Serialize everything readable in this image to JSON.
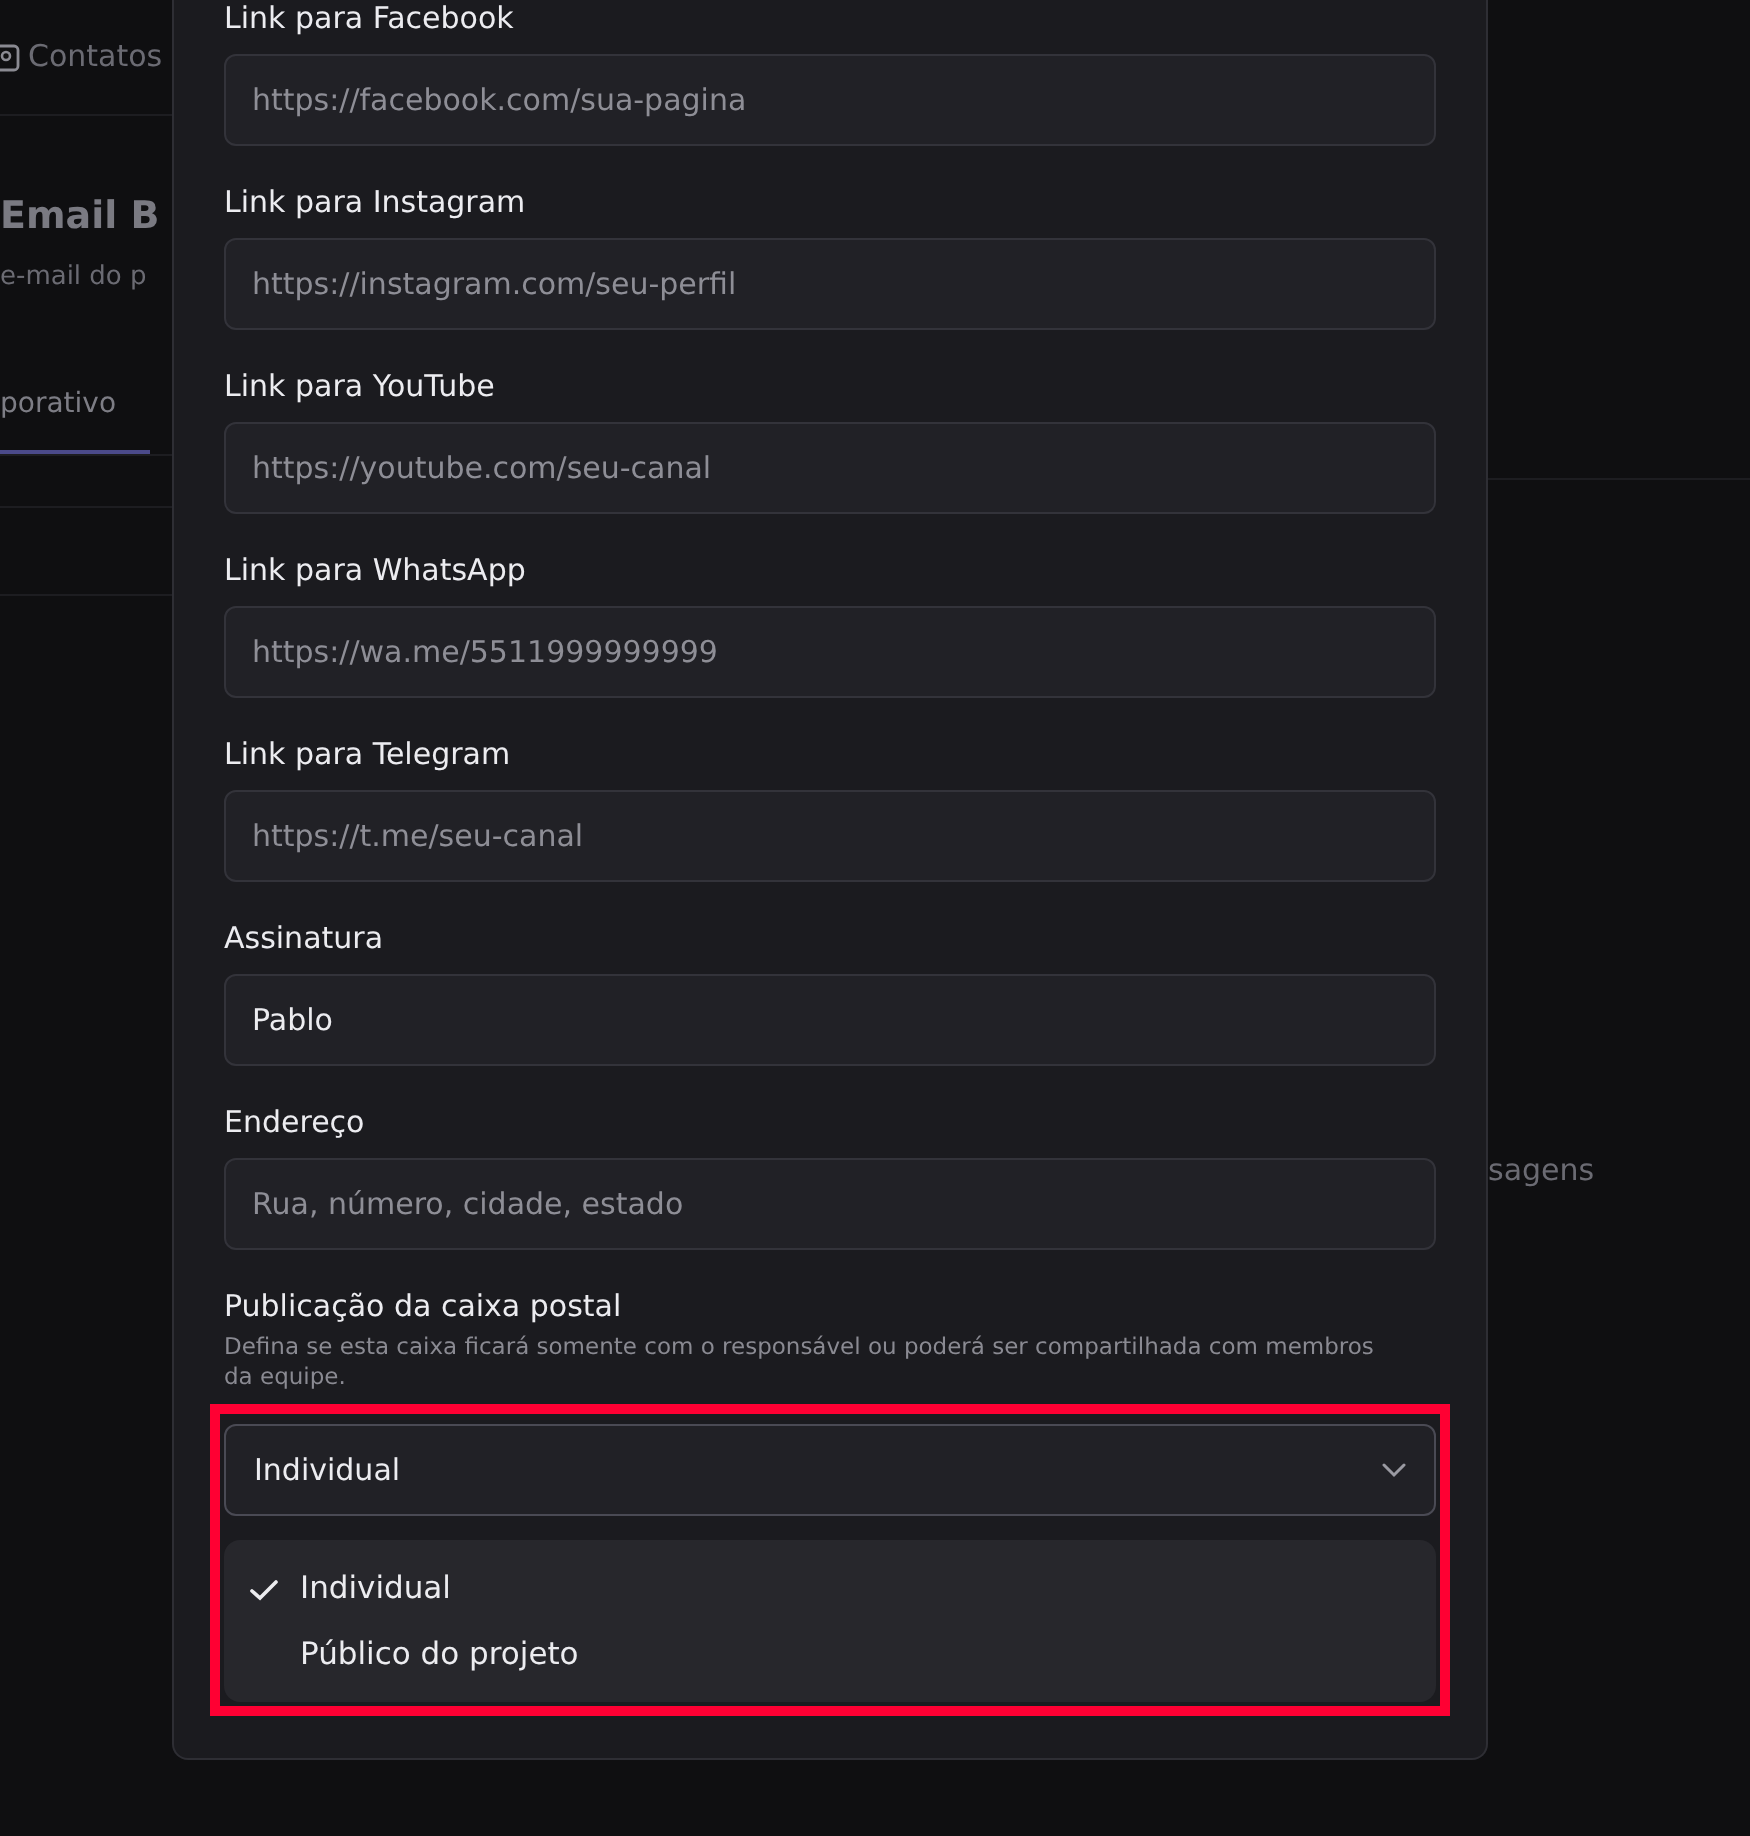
{
  "background": {
    "nav_item": "Contatos",
    "title": "Email B",
    "subtitle": "e-mail do p",
    "tab": {
      "label": "porativo",
      "selected": true
    },
    "side_text": "sagens"
  },
  "modal": {
    "fields": [
      {
        "label": "Link para Facebook",
        "placeholder": "https://facebook.com/sua-pagina"
      },
      {
        "label": "Link para Instagram",
        "placeholder": "https://instagram.com/seu-perfil"
      },
      {
        "label": "Link para YouTube",
        "placeholder": "https://youtube.com/seu-canal"
      },
      {
        "label": "Link para WhatsApp",
        "placeholder": "https://wa.me/5511999999999"
      },
      {
        "label": "Link para Telegram",
        "placeholder": "https://t.me/seu-canal"
      },
      {
        "label": "Assinatura",
        "value": "Pablo"
      },
      {
        "label": "Endereço",
        "placeholder": "Rua, número, cidade, estado"
      }
    ],
    "select": {
      "label": "Publicação da caixa postal",
      "help": "Defina se esta caixa ficará somente com o responsável ou poderá ser compartilhada com membros da equipe.",
      "value": "Individual",
      "expanded": true,
      "highlighted": true,
      "options": [
        {
          "label": "Individual",
          "selected": true
        },
        {
          "label": "Público do projeto",
          "selected": false
        }
      ]
    }
  }
}
